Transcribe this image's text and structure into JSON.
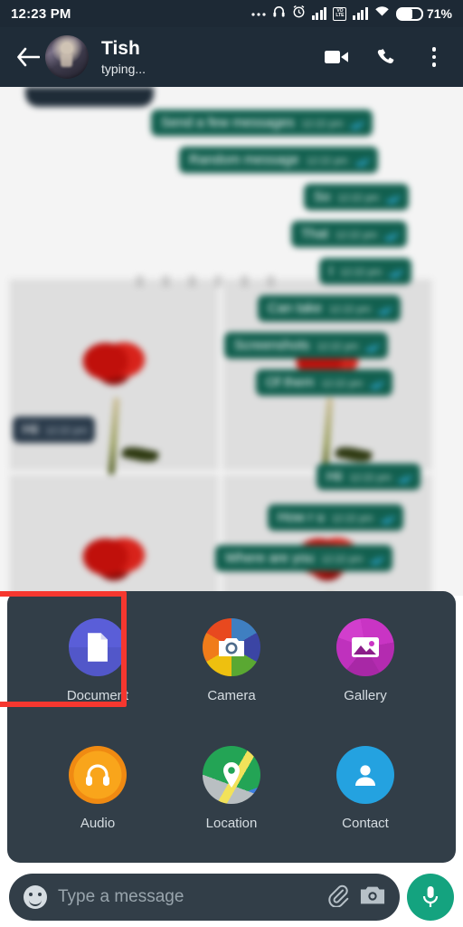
{
  "statusbar": {
    "time": "12:23 PM",
    "battery_percent": "71%",
    "icons": [
      "more-dots-icon",
      "headphone-icon",
      "alarm-icon",
      "signal-bars-icon",
      "volte-icon",
      "signal-bars-2-icon",
      "wifi-icon",
      "battery-icon"
    ],
    "volte_label_top": "VO",
    "volte_label_bottom": "LTE"
  },
  "header": {
    "contact_name": "Tish",
    "status_text": "typing...",
    "back_icon": "back-arrow-icon",
    "video_icon": "video-call-icon",
    "call_icon": "phone-call-icon",
    "menu_icon": "overflow-menu-icon"
  },
  "chat": {
    "messages": [
      {
        "text": "Send a few messages",
        "time": "12:22 pm",
        "direction": "out",
        "status": "read"
      },
      {
        "text": "Random message",
        "time": "12:22 pm",
        "direction": "out",
        "status": "read"
      },
      {
        "text": "So",
        "time": "12:22 pm",
        "direction": "out",
        "status": "read"
      },
      {
        "text": "That",
        "time": "12:22 pm",
        "direction": "out",
        "status": "read"
      },
      {
        "text": "I",
        "time": "12:22 pm",
        "direction": "out",
        "status": "read"
      },
      {
        "text": "Can take",
        "time": "12:22 pm",
        "direction": "out",
        "status": "read"
      },
      {
        "text": "Screenshots",
        "time": "12:22 pm",
        "direction": "out",
        "status": "read"
      },
      {
        "text": "Of them",
        "time": "12:22 pm",
        "direction": "out",
        "status": "read"
      },
      {
        "text": "Hii",
        "time": "12:22 pm",
        "direction": "in",
        "status": "none"
      },
      {
        "text": "Hii",
        "time": "12:22 pm",
        "direction": "out",
        "status": "read"
      },
      {
        "text": "How r u",
        "time": "12:22 pm",
        "direction": "out",
        "status": "read"
      },
      {
        "text": "Where are you",
        "time": "12:22 pm",
        "direction": "out",
        "status": "read"
      }
    ]
  },
  "attachment_panel": {
    "items": [
      {
        "label": "Document",
        "icon": "document-icon",
        "highlighted": true
      },
      {
        "label": "Camera",
        "icon": "camera-icon",
        "highlighted": false
      },
      {
        "label": "Gallery",
        "icon": "gallery-icon",
        "highlighted": false
      },
      {
        "label": "Audio",
        "icon": "audio-icon",
        "highlighted": false
      },
      {
        "label": "Location",
        "icon": "location-icon",
        "highlighted": false
      },
      {
        "label": "Contact",
        "icon": "contact-icon",
        "highlighted": false
      }
    ],
    "highlight_color": "#f6372f"
  },
  "input_bar": {
    "placeholder": "Type a message",
    "emoji_icon": "emoji-icon",
    "attach_icon": "paperclip-icon",
    "camera_icon": "camera-icon",
    "mic_icon": "microphone-icon",
    "mic_color": "#14a37f"
  }
}
